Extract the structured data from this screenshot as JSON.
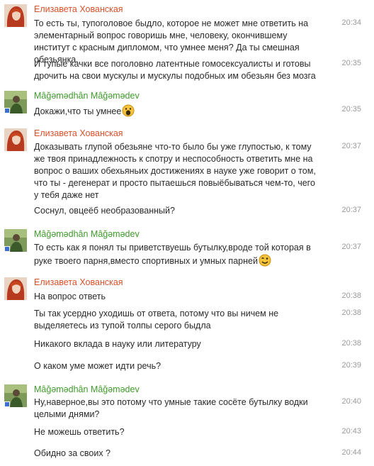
{
  "users": {
    "elizaveta": {
      "name": "Елизавета Хованская",
      "color": "#d8512a"
    },
    "magomedkhan": {
      "name": "Mâğəmədhân Mâğəmədev",
      "color": "#3f9a2b"
    }
  },
  "messages": [
    {
      "text": "То есть ты, тупоголовое быдло, которое не может мне ответить на элементарный вопрос говоришь мне, человеку, окончившему институт с красным дипломом, что умнее меня? Да ты смешная обезьянка.",
      "time": "20:34"
    },
    {
      "text": "И тупые качки все поголовно латентные гомосексуалисты и готовы дрочить на свои мускулы и мускулы подобных им обезьян без мозга",
      "time": "20:35"
    },
    {
      "text": "Докажи,что ты умнее",
      "time": "20:35"
    },
    {
      "text": "Доказывать глупой обезьяне что-то было бы уже глупостью, к тому же твоя принадлежность к спотру и неспособность ответить мне на вопрос о ваших обехьяньих достижениях в науке уже говорит о том, что ты - дегенерат и просто пытаешься повыёбываться чем-то, чего у тебя даже нет",
      "time": "20:37"
    },
    {
      "text": "Соснул, овцеёб необразованный?",
      "time": "20:37"
    },
    {
      "text": "То есть как я понял ты приветствуешь бутылку,вроде той которая в руке твоего парня,вместо спортивных и умных парней",
      "time": "20:37"
    },
    {
      "text": "На вопрос ответь",
      "time": "20:38"
    },
    {
      "text": "Ты так усердно уходишь от ответа, потому что вы ничем не выделяетесь из тупой толпы серого быдла",
      "time": "20:38"
    },
    {
      "text": "Никакого вклада в науку или литературу",
      "time": "20:38"
    },
    {
      "text": "О каком уме может идти речь?",
      "time": "20:39"
    },
    {
      "text": "Ну,наверное,вы это потому что умные такие сосёте бутылку водки целыми днями?",
      "time": "20:40"
    },
    {
      "text": "Не можешь ответить?",
      "time": "20:43"
    },
    {
      "text": "Обидно за своих ?",
      "time": "20:44"
    }
  ],
  "icons": {
    "emoji_1": "screaming-smiley-icon",
    "emoji_2": "winking-smiley-icon"
  }
}
